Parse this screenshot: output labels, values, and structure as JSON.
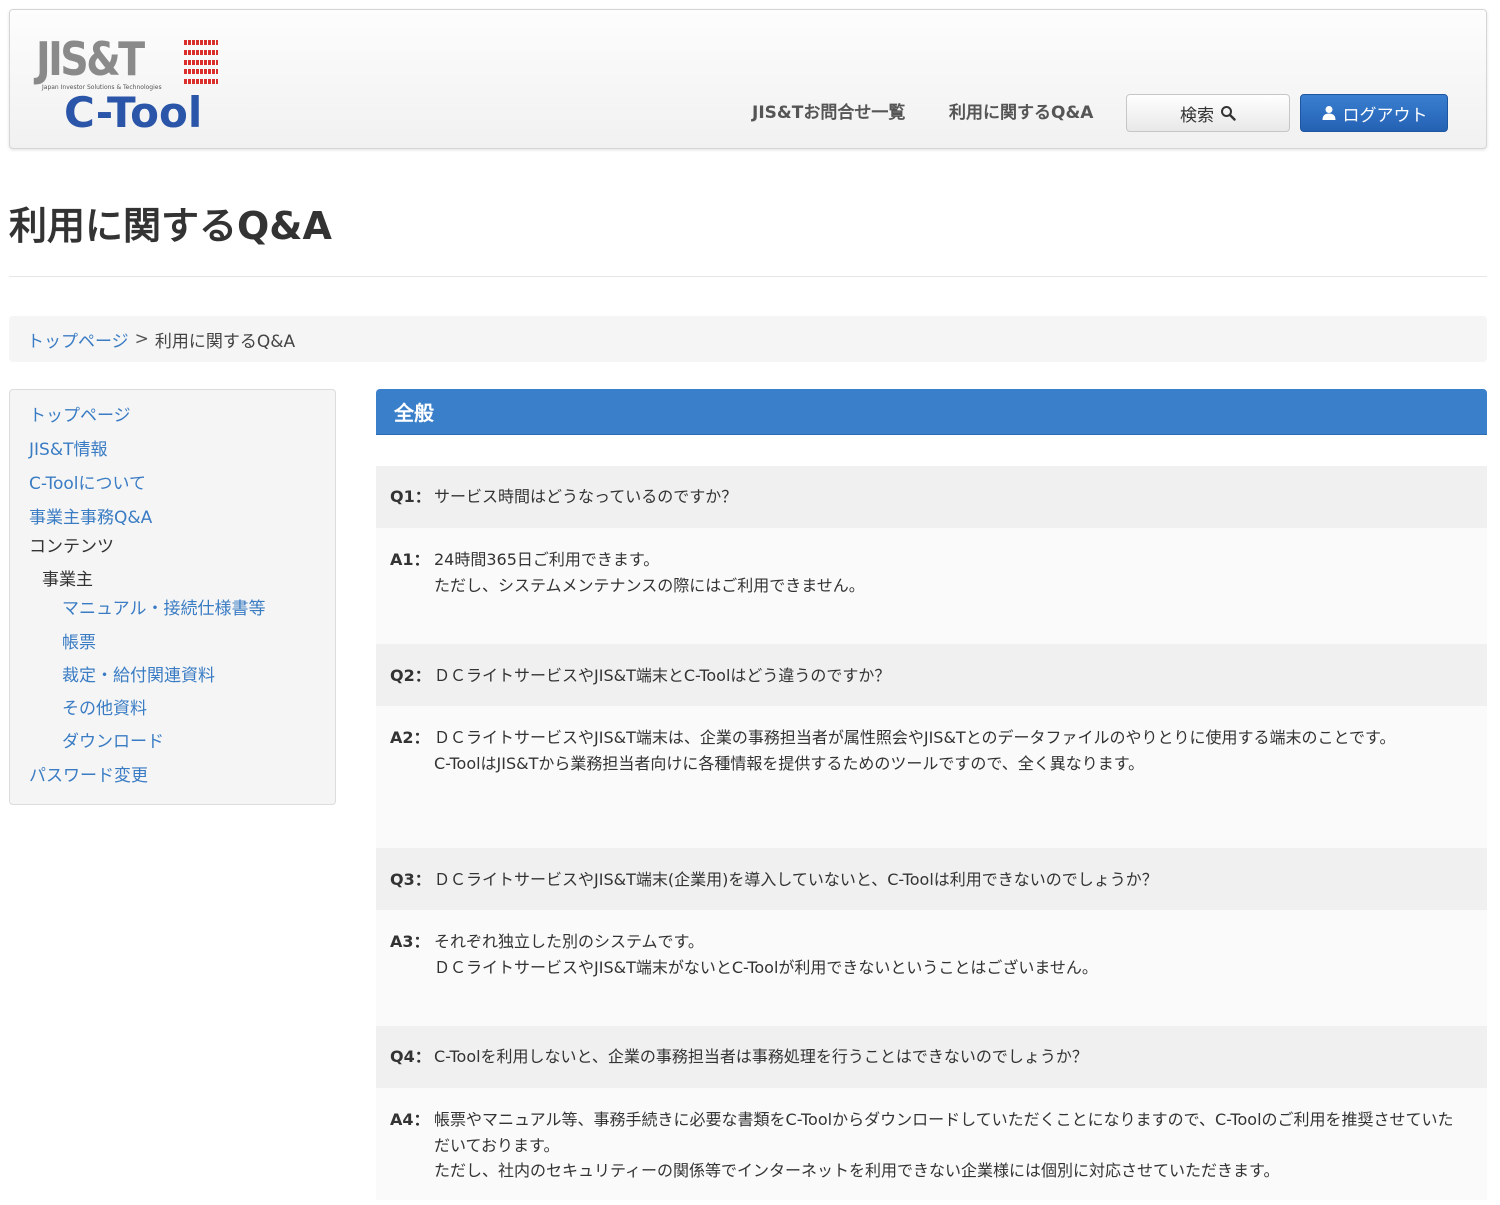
{
  "header": {
    "logo_main": "JIS&T",
    "logo_sub": "Japan Investor Solutions & Technologies",
    "logo_product": "C-Tool",
    "nav": [
      {
        "label": "JIS&Tお問合せ一覧"
      },
      {
        "label": "利用に関するQ&A"
      }
    ],
    "search_label": "検索",
    "logout_label": "ログアウト",
    "colors": {
      "logout_button": "#2461b3",
      "logo_red": "#d9302b",
      "logo_blue": "#2a55a8"
    }
  },
  "page": {
    "title": "利用に関するQ&A"
  },
  "breadcrumb": {
    "home": "トップページ",
    "separator": ">",
    "current": "利用に関するQ&A"
  },
  "sidebar": {
    "items": [
      {
        "label": "トップページ"
      },
      {
        "label": "JIS&T情報"
      },
      {
        "label": "C-Toolについて"
      },
      {
        "label": "事業主事務Q&A"
      },
      {
        "label": "コンテンツ"
      },
      {
        "label": "事業主"
      },
      {
        "label": "マニュアル・接続仕様書等"
      },
      {
        "label": "帳票"
      },
      {
        "label": "裁定・給付関連資料"
      },
      {
        "label": "その他資料"
      },
      {
        "label": "ダウンロード"
      },
      {
        "label": "パスワード変更"
      }
    ]
  },
  "main": {
    "section_title": "全般",
    "section_color": "#3a7fca",
    "qa": [
      {
        "q_label": "Q1：",
        "question": "サービス時間はどうなっているのですか？",
        "a_label": "A1：",
        "answer": [
          "24時間365日ご利用できます。",
          "ただし、システムメンテナンスの際にはご利用できません。"
        ]
      },
      {
        "q_label": "Q2：",
        "question": "ＤＣライトサービスやJIS&T端末とC-Toolはどう違うのですか？",
        "a_label": "A2：",
        "answer": [
          "ＤＣライトサービスやJIS&T端末は、企業の事務担当者が属性照会やJIS&Tとのデータファイルのやりとりに使用する端末のことです。",
          "C-ToolはJIS&Tから業務担当者向けに各種情報を提供するためのツールですので、全く異なります。"
        ]
      },
      {
        "q_label": "Q3：",
        "question": "ＤＣライトサービスやJIS&T端末(企業用)を導入していないと、C-Toolは利用できないのでしょうか？",
        "a_label": "A3：",
        "answer": [
          "それぞれ独立した別のシステムです。",
          "ＤＣライトサービスやJIS&T端末がないとC-Toolが利用できないということはございません。"
        ]
      },
      {
        "q_label": "Q4：",
        "question": "C-Toolを利用しないと、企業の事務担当者は事務処理を行うことはできないのでしょうか？",
        "a_label": "A4：",
        "answer": [
          "帳票やマニュアル等、事務手続きに必要な書類をC-Toolからダウンロードしていただくことになりますので、C-Toolのご利用を推奨させていただいております。",
          "ただし、社内のセキュリティーの関係等でインターネットを利用できない企業様には個別に対応させていただきます。"
        ]
      }
    ]
  }
}
